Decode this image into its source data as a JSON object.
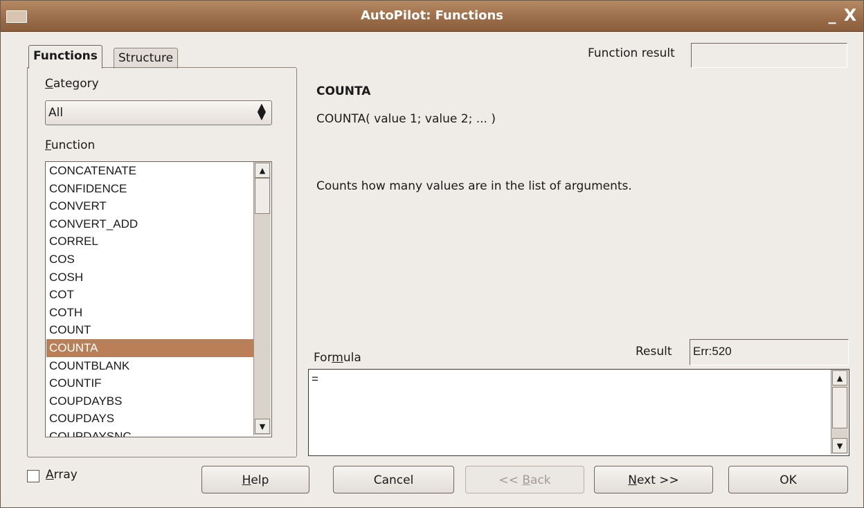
{
  "window": {
    "title": "AutoPilot: Functions",
    "minimize": "_",
    "close": "X"
  },
  "tabs": [
    {
      "label": "Functions"
    },
    {
      "label": "Structure"
    }
  ],
  "category": {
    "label_u": "C",
    "label_rest": "ategory",
    "value": "All"
  },
  "function_list": {
    "label_u": "F",
    "label_rest": "unction",
    "items": [
      "CONCATENATE",
      "CONFIDENCE",
      "CONVERT",
      "CONVERT_ADD",
      "CORREL",
      "COS",
      "COSH",
      "COT",
      "COTH",
      "COUNT",
      "COUNTA",
      "COUNTBLANK",
      "COUNTIF",
      "COUPDAYBS",
      "COUPDAYS",
      "COUPDAYSNC"
    ],
    "selected": "COUNTA"
  },
  "details": {
    "name": "COUNTA",
    "syntax": "COUNTA( value 1; value 2; ...  )",
    "description": "Counts how many values are in the list of arguments."
  },
  "function_result": {
    "label": "Function result",
    "value": ""
  },
  "formula": {
    "label_pre": "For",
    "label_u": "m",
    "label_post": "ula",
    "value": "="
  },
  "result": {
    "label": "Result",
    "value": "Err:520"
  },
  "array": {
    "label_u": "A",
    "label_rest": "rray",
    "checked": false
  },
  "buttons": {
    "help": {
      "u": "H",
      "rest": "elp"
    },
    "cancel": {
      "label": "Cancel"
    },
    "back": {
      "pre": "<< ",
      "u": "B",
      "rest": "ack"
    },
    "next": {
      "u": "N",
      "rest": "ext >>"
    },
    "ok": {
      "label": "OK"
    }
  }
}
